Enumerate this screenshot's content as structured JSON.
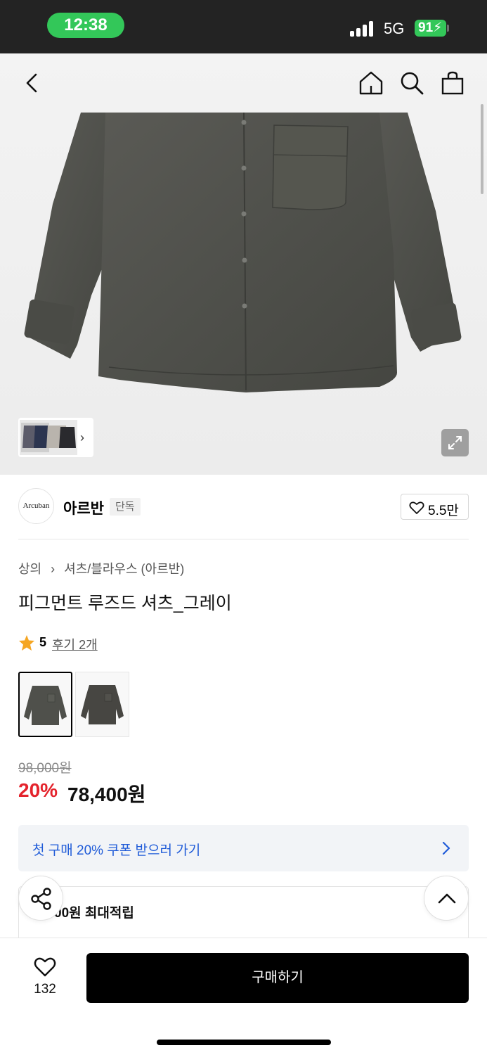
{
  "status_bar": {
    "time": "12:38",
    "network": "5G",
    "battery": "91"
  },
  "colors": {
    "accent_red": "#e4232c",
    "coupon_blue": "#1f5bd8",
    "status_green": "#33c759",
    "star": "#f5a623"
  },
  "header": {
    "icons": [
      "chevron-left-icon",
      "home-icon",
      "search-icon",
      "shopping-bag-icon"
    ]
  },
  "gallery": {
    "thumbnail_icon": "chevron-right-icon",
    "expand_icon": "expand-icon"
  },
  "brand": {
    "logo_text": "Arcuban",
    "name": "아르반",
    "badge": "단독",
    "like_count": "5.5만"
  },
  "product": {
    "breadcrumb": [
      "상의",
      "셔츠/블라우스 (아르반)"
    ],
    "title": "피그먼트 루즈드 셔츠_그레이",
    "rating": "5",
    "review_text": "후기 2개",
    "original_price": "98,000원",
    "discount": "20%",
    "final_price": "78,400원"
  },
  "coupon": {
    "text": "첫 구매 20% 쿠폰 받으러 가기"
  },
  "points": {
    "text": "00원 최대적립"
  },
  "bottom_bar": {
    "wish_count": "132",
    "buy_label": "구매하기"
  }
}
